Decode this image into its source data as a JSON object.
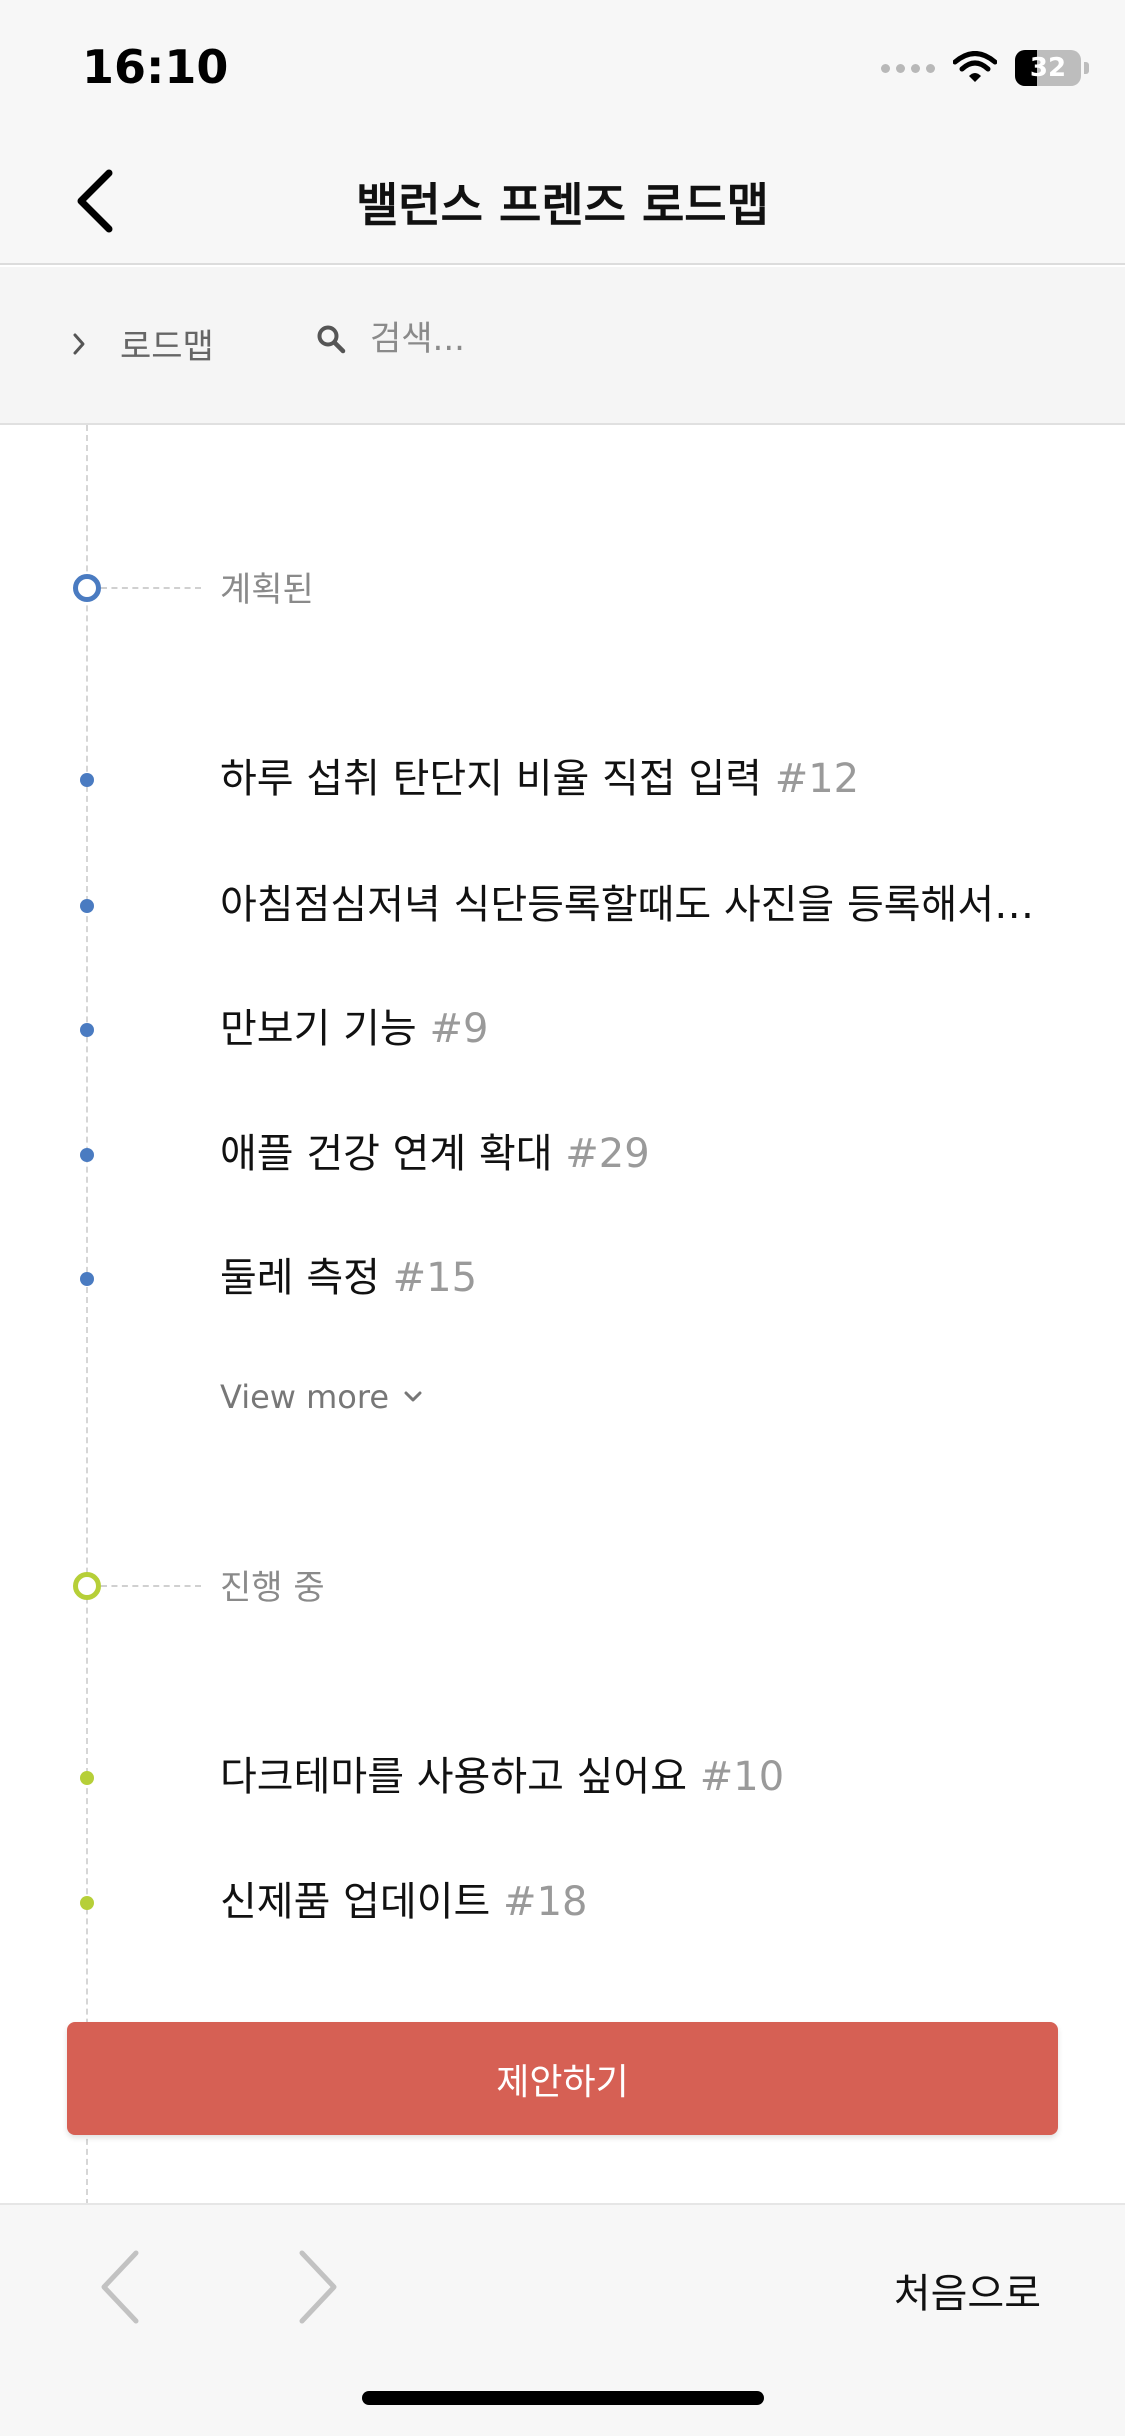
{
  "status_bar": {
    "time": "16:10",
    "battery": "32"
  },
  "nav": {
    "title": "밸런스 프렌즈 로드맵"
  },
  "subbar": {
    "breadcrumb": "로드맵",
    "search_placeholder": "검색..."
  },
  "sections": [
    {
      "label": "계획된",
      "color": "#4a7bc1",
      "items": [
        {
          "title": "하루 섭취 탄단지 비율 직접 입력",
          "number": "#12"
        },
        {
          "title": "아침점심저녁 식단등록할때도 사진을 등록해서 보고싶어요",
          "number": ""
        },
        {
          "title": "만보기 기능",
          "number": "#9"
        },
        {
          "title": "애플 건강 연계 확대",
          "number": "#29"
        },
        {
          "title": "둘레 측정",
          "number": "#15"
        }
      ],
      "view_more": "View more"
    },
    {
      "label": "진행 중",
      "color": "#b6cf38",
      "items": [
        {
          "title": "다크테마를 사용하고 싶어요",
          "number": "#10"
        },
        {
          "title": "신제품 업데이트",
          "number": "#18"
        }
      ]
    }
  ],
  "suggest_button": "제안하기",
  "bottom_nav": {
    "home_label": "처음으로"
  },
  "colors": {
    "accent": "#d66054",
    "planned": "#4a7bc1",
    "in_progress": "#b6cf38"
  },
  "icons": [
    "back-chevron-icon",
    "chevron-right-icon",
    "search-icon",
    "chevron-down-icon",
    "wifi-icon",
    "battery-icon",
    "arrow-left-icon",
    "arrow-right-icon"
  ]
}
